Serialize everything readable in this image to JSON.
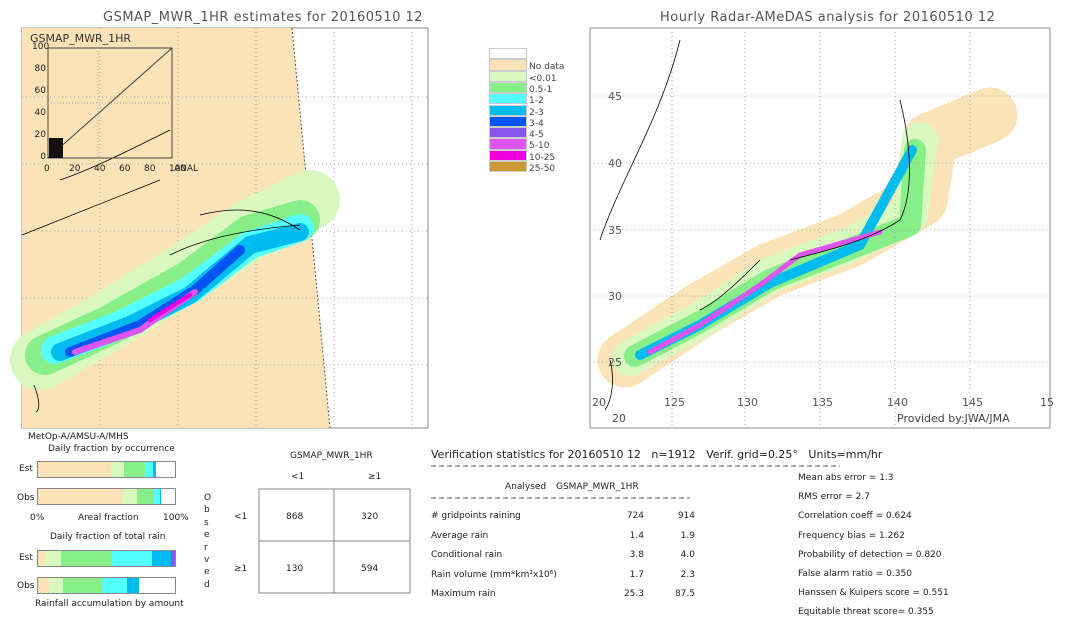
{
  "left_map": {
    "title": "GSMAP_MWR_1HR estimates for 20160510 12",
    "inset_label": "GSMAP_MWR_1HR",
    "inset_xlabel": "ANAL",
    "inset_ticks": [
      "0",
      "20",
      "40",
      "60",
      "80",
      "100"
    ],
    "satellite": "MetOp-A/AMSU-A/MHS"
  },
  "right_map": {
    "title": "Hourly Radar-AMeDAS analysis for 20160510 12",
    "lat_ticks": [
      "45",
      "40",
      "35",
      "30",
      "25"
    ],
    "lon_ticks": [
      "20",
      "125",
      "130",
      "135",
      "140",
      "145",
      "15"
    ],
    "bottom_lat": "20",
    "credit": "Provided by:JWA/JMA"
  },
  "legend": {
    "items": [
      {
        "label": "",
        "color": "#ffffff"
      },
      {
        "label": "No data",
        "color": "#fbe3b8"
      },
      {
        "label": "<0.01",
        "color": "#d8f8c0"
      },
      {
        "label": "0.5-1",
        "color": "#88ee88"
      },
      {
        "label": "1-2",
        "color": "#55ffff"
      },
      {
        "label": "2-3",
        "color": "#00bbee"
      },
      {
        "label": "3-4",
        "color": "#0055ee"
      },
      {
        "label": "4-5",
        "color": "#8855ee"
      },
      {
        "label": "5-10",
        "color": "#dd55ee"
      },
      {
        "label": "10-25",
        "color": "#ee00dd"
      },
      {
        "label": "25-50",
        "color": "#cc9933"
      }
    ]
  },
  "fractions": {
    "occurrence_title": "Daily fraction by occurrence",
    "est": "Est",
    "obs": "Obs",
    "zero": "0%",
    "axis": "Areal fraction",
    "hundred": "100%",
    "total_title": "Daily fraction of total rain",
    "accum_label": "Rainfall accumulation by amount",
    "occ_est": [
      53,
      10,
      15,
      6,
      2
    ],
    "occ_obs": [
      62,
      10,
      13,
      4,
      1
    ],
    "tot_est": [
      5,
      12,
      37,
      29,
      14,
      3
    ],
    "tot_obs": [
      8,
      10,
      29,
      18,
      9,
      0
    ]
  },
  "contingency": {
    "title": "GSMAP_MWR_1HR",
    "col_lt": "<1",
    "col_ge": "≥1",
    "row_lt": "<1",
    "row_ge": "≥1",
    "observed": [
      "O",
      "b",
      "s",
      "e",
      "r",
      "v",
      "e",
      "d"
    ],
    "cells": [
      [
        "868",
        "320"
      ],
      [
        "130",
        "594"
      ]
    ]
  },
  "stats": {
    "heading": "Verification statistics for 20160510 12   n=1912   Verif. grid=0.25°   Units=mm/hr",
    "col_analysed": "Analysed",
    "col_gsmap": "GSMAP_MWR_1HR",
    "rows": [
      {
        "label": "# gridpoints raining",
        "a": "724",
        "g": "914"
      },
      {
        "label": "Average rain",
        "a": "1.4",
        "g": "1.9"
      },
      {
        "label": "Conditional rain",
        "a": "3.8",
        "g": "4.0"
      },
      {
        "label": "Rain volume (mm*km²x10⁶)",
        "a": "1.7",
        "g": "2.3"
      },
      {
        "label": "Maximum rain",
        "a": "25.3",
        "g": "87.5"
      }
    ],
    "scores": [
      "Mean abs error = 1.3",
      "RMS error = 2.7",
      "Correlation coeff = 0.624",
      "Frequency bias = 1.262",
      "Probability of detection = 0.820",
      "False alarm ratio = 0.350",
      "Hanssen & Kuipers score = 0.551",
      "Equitable threat score= 0.355"
    ]
  }
}
